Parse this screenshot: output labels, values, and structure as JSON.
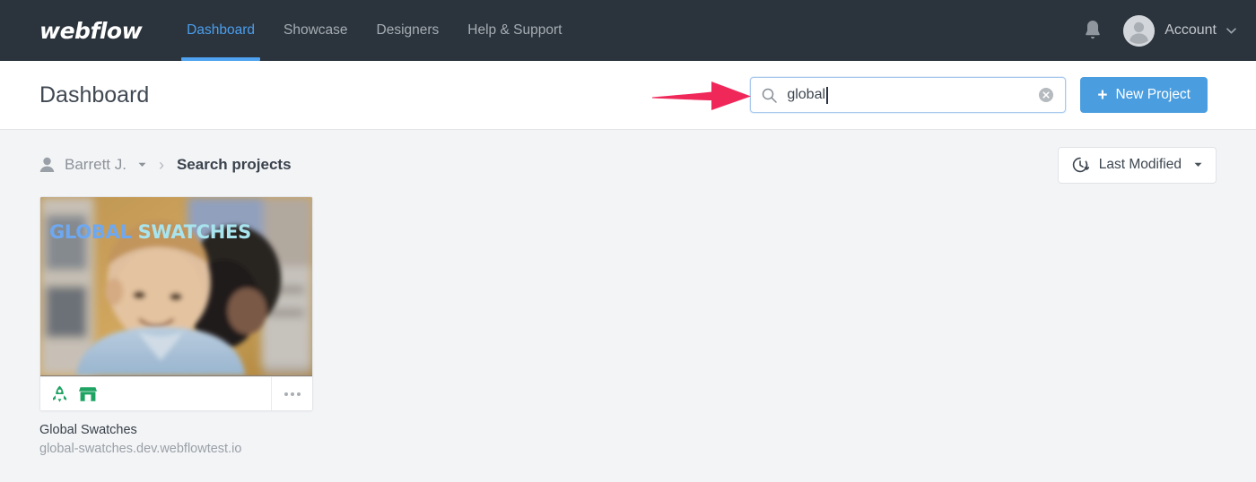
{
  "topnav": {
    "logo": "webflow",
    "links": [
      {
        "label": "Dashboard",
        "active": true
      },
      {
        "label": "Showcase",
        "active": false
      },
      {
        "label": "Designers",
        "active": false
      },
      {
        "label": "Help & Support",
        "active": false
      }
    ],
    "notifications_icon": "bell-icon",
    "avatar_icon": "user-avatar",
    "account_label": "Account",
    "account_caret_icon": "chevron-down-icon",
    "bg_color": "#2b333c",
    "active_color": "#4a9fee"
  },
  "subheader": {
    "title": "Dashboard",
    "search": {
      "value": "global",
      "placeholder": "Search projects",
      "icon": "search-icon",
      "clear_icon": "clear-circle-icon",
      "focused": true,
      "border_color": "#a8c9ec"
    },
    "new_project": {
      "label": "New Project",
      "plus": "+",
      "color": "#4a9ee0"
    }
  },
  "annotation": {
    "type": "arrow",
    "direction": "right",
    "color": "#f0285a",
    "points_to": "search-input"
  },
  "breadcrumb": {
    "user_icon": "person-icon",
    "user_name": "Barrett J.",
    "user_caret_icon": "caret-down-icon",
    "separator": "›",
    "current": "Search projects"
  },
  "sort": {
    "icon": "clock-arrow-icon",
    "label": "Last Modified",
    "caret_icon": "caret-down-icon"
  },
  "projects": [
    {
      "name": "Global Swatches",
      "url": "global-swatches.dev.webflowtest.io",
      "thumb_caption_part1": "GLOBAL",
      "thumb_caption_part2": "SWATCHES",
      "badges": [
        {
          "icon": "rocket-icon",
          "title": "Published",
          "color": "#1fa363"
        },
        {
          "icon": "storefront-icon",
          "title": "Ecommerce",
          "color": "#1fa363"
        }
      ],
      "menu_icon": "more-options-icon"
    }
  ],
  "colors": {
    "page_bg": "#f3f4f6",
    "panel_bg": "#ffffff",
    "accent_blue": "#4a9ee0",
    "badge_green": "#1fa363",
    "annotation_pink": "#f0285a"
  }
}
